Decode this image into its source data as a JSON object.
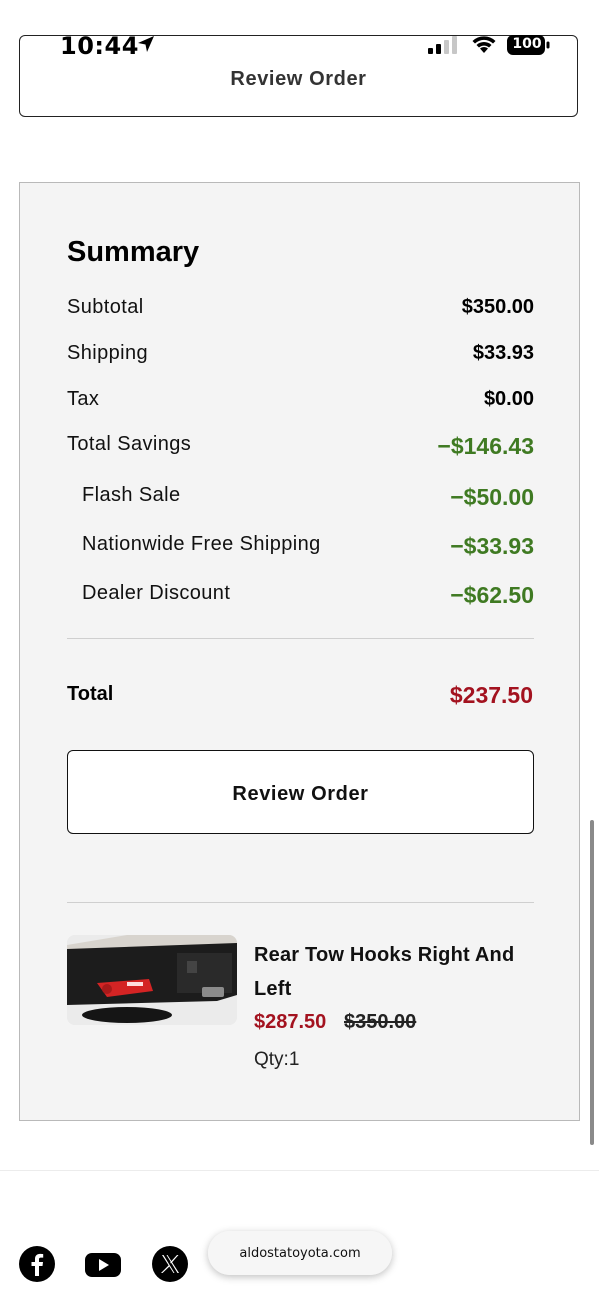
{
  "status_bar": {
    "time": "10:44",
    "battery": "100"
  },
  "top_button": {
    "label": "Review Order"
  },
  "summary": {
    "title": "Summary",
    "rows": [
      {
        "label": "Subtotal",
        "value": "$350.00"
      },
      {
        "label": "Shipping",
        "value": "$33.93"
      },
      {
        "label": "Tax",
        "value": "$0.00"
      },
      {
        "label": "Total Savings",
        "value": "−$146.43"
      }
    ],
    "savings": [
      {
        "label": "Flash Sale",
        "value": "−$50.00"
      },
      {
        "label": "Nationwide Free Shipping",
        "value": "−$33.93"
      },
      {
        "label": "Dealer Discount",
        "value": "−$62.50"
      }
    ],
    "total_label": "Total",
    "total_value": "$237.50",
    "review_button_label": "Review Order"
  },
  "product": {
    "name": "Rear Tow Hooks Right And Left",
    "sale_price": "$287.50",
    "original_price": "$350.00",
    "qty": "Qty:1"
  },
  "footer": {
    "url": "aldostatoyota.com",
    "social_icons": [
      "facebook-icon",
      "youtube-icon",
      "x-icon"
    ]
  },
  "colors": {
    "savings_green": "#3f7a22",
    "price_red": "#a3121f",
    "card_bg": "#f4f4f4"
  }
}
